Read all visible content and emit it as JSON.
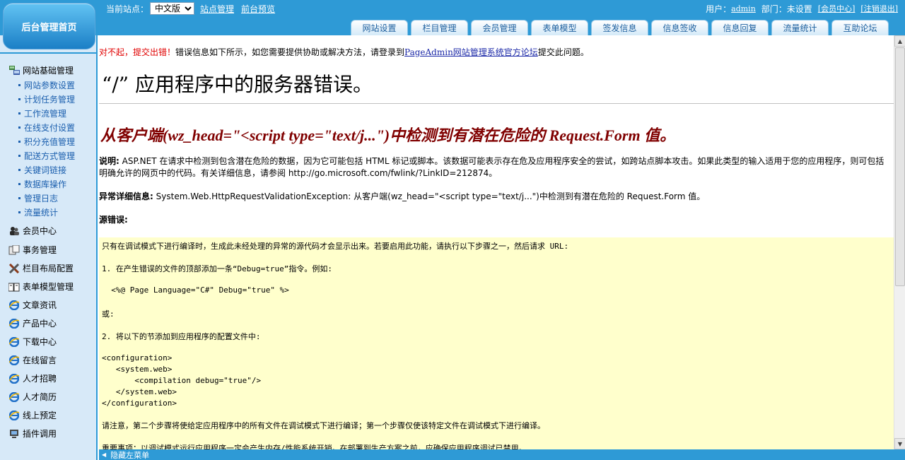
{
  "header": {
    "home_button": "后台管理首页",
    "current_site_label": "当前站点：",
    "site_select_value": "中文版",
    "site_manage_link": "站点管理",
    "preview_link": "前台预览",
    "user_label": "用户：",
    "user_name": "admin",
    "dept_text": "部门：未设置",
    "member_center_link": "[会员中心]",
    "logout_link": "[注销退出]"
  },
  "tabs": [
    "网站设置",
    "栏目管理",
    "会员管理",
    "表单模型",
    "签发信息",
    "信息签收",
    "信息回复",
    "流量统计",
    "互助论坛"
  ],
  "sidebar": {
    "groups": [
      {
        "label": "网站基础管理",
        "icon": "site-tree-icon"
      },
      {
        "label": "会员中心",
        "icon": "members-icon"
      },
      {
        "label": "事务管理",
        "icon": "affairs-icon"
      },
      {
        "label": "栏目布局配置",
        "icon": "tools-icon"
      },
      {
        "label": "表单模型管理",
        "icon": "form-book-icon"
      },
      {
        "label": "文章资讯",
        "icon": "ie-icon"
      },
      {
        "label": "产品中心",
        "icon": "ie-icon"
      },
      {
        "label": "下载中心",
        "icon": "ie-icon"
      },
      {
        "label": "在线留言",
        "icon": "ie-icon"
      },
      {
        "label": "人才招聘",
        "icon": "ie-icon"
      },
      {
        "label": "人才简历",
        "icon": "ie-icon"
      },
      {
        "label": "线上预定",
        "icon": "ie-icon"
      },
      {
        "label": "插件调用",
        "icon": "plugin-icon"
      }
    ],
    "sub_items": [
      "网站参数设置",
      "计划任务管理",
      "工作流管理",
      "在线支付设置",
      "积分充值管理",
      "配送方式管理",
      "关键词链接",
      "数据库操作",
      "管理日志",
      "流量统计"
    ]
  },
  "main": {
    "notice_red": "对不起，提交出错！",
    "notice_text": "错误信息如下所示，如您需要提供协助或解决方法，请登录到",
    "notice_link": "PageAdmin网站管理系统官方论坛",
    "notice_tail": "提交此问题。",
    "error_title": "“/” 应用程序中的服务器错误。",
    "error_subtitle": "从客户端(wz_head=\"<script type=\"text/j...\")中检测到有潜在危险的 Request.Form 值。",
    "desc_label": "说明:",
    "desc_text": "ASP.NET 在请求中检测到包含潜在危险的数据，因为它可能包括 HTML 标记或脚本。该数据可能表示存在危及应用程序安全的尝试，如跨站点脚本攻击。如果此类型的输入适用于您的应用程序，则可包括明确允许的网页中的代码。有关详细信息，请参阅 http://go.microsoft.com/fwlink/?LinkID=212874。",
    "exception_label": "异常详细信息:",
    "exception_text": "System.Web.HttpRequestValidationException: 从客户端(wz_head=\"<script type=\"text/j...\")中检测到有潜在危险的 Request.Form 值。",
    "source_error_label": "源错误:",
    "code_lines": [
      "只有在调试模式下进行编译时，生成此未经处理的异常的源代码才会显示出来。若要启用此功能，请执行以下步骤之一，然后请求 URL:",
      "1. 在产生错误的文件的顶部添加一条“Debug=true”指令。例如:",
      "  <%@ Page Language=\"C#\" Debug=\"true\" %>",
      "或:",
      "2. 将以下的节添加到应用程序的配置文件中:",
      "<configuration>",
      "   <system.web>",
      "       <compilation debug=\"true\"/>",
      "   </system.web>",
      "</configuration>",
      "请注意，第二个步骤将使给定应用程序中的所有文件在调试模式下进行编译；第一个步骤仅使该特定文件在调试模式下进行编译。",
      "重要事项：以调试模式运行应用程序一定会产生内存/性能系统开销。在部署到生产方案之前，应确保应用程序调试已禁用。"
    ]
  },
  "bottom": {
    "hide_menu": "隐藏左菜单"
  },
  "colors": {
    "bar_blue": "#2e9ad6",
    "sidebar_bg": "#d7e9f8",
    "code_bg": "#ffffcc",
    "error_subtitle": "#800000"
  }
}
